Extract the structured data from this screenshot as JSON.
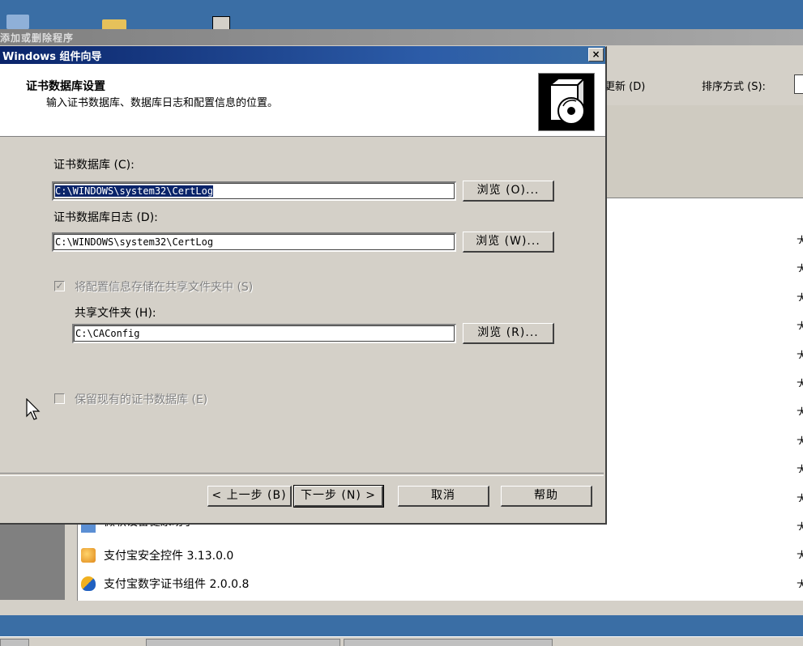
{
  "background_window": {
    "caption": "添加或删除程序",
    "refresh_label": "更新 (D)",
    "sort_label": "排序方式 (S):",
    "size_col_glyph": "大",
    "programs": [
      {
        "name": "微软设备健康助手"
      },
      {
        "name": "支付宝安全控件 3.13.0.0"
      },
      {
        "name": "支付宝数字证书组件 2.0.0.8"
      }
    ]
  },
  "dialog": {
    "title": "Windows 组件向导",
    "close_glyph": "×",
    "header_title": "证书数据库设置",
    "header_subtitle": "输入证书数据库、数据库日志和配置信息的位置。",
    "db_label": "证书数据库 (C):",
    "db_value": "C:\\WINDOWS\\system32\\CertLog",
    "db_browse": "浏览 (O)...",
    "log_label": "证书数据库日志 (D):",
    "log_value": "C:\\WINDOWS\\system32\\CertLog",
    "log_browse": "浏览 (W)...",
    "store_shared_label": "将配置信息存储在共享文件夹中 (S)",
    "store_shared_checked": true,
    "shared_folder_label": "共享文件夹 (H):",
    "shared_folder_value": "C:\\CAConfig",
    "shared_browse": "浏览 (R)...",
    "keep_db_label": "保留现有的证书数据库 (E)",
    "keep_db_checked": false,
    "back_button": "< 上一步 (B)",
    "next_button": "下一步 (N) >",
    "cancel_button": "取消",
    "help_button": "帮助"
  },
  "colors": {
    "title_bar": "#0a246a",
    "desktop_blue": "#3a6ea5",
    "face": "#d4d0c8"
  }
}
